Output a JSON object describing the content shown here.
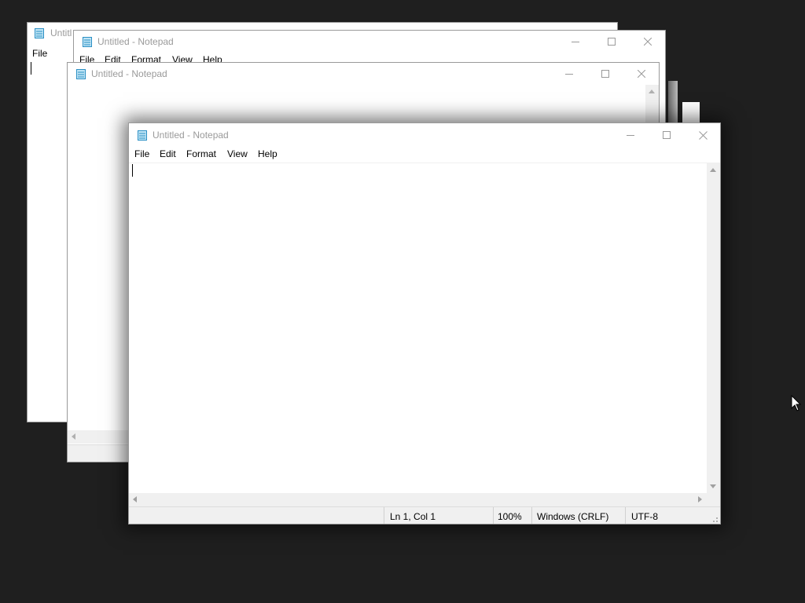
{
  "app": {
    "window_title": "Untitled - Notepad",
    "truncated_title": "Untitl",
    "menu": {
      "file": "File",
      "edit": "Edit",
      "format": "Format",
      "view": "View",
      "help": "Help"
    },
    "status": {
      "position": "Ln 1, Col 1",
      "zoom": "100%",
      "line_ending": "Windows (CRLF)",
      "encoding": "UTF-8"
    },
    "editor_text": ""
  },
  "icons": {
    "app": "notepad-icon",
    "minimize": "minimize-icon",
    "maximize": "maximize-icon",
    "close": "close-icon",
    "cursor": "mouse-pointer-icon"
  },
  "colors": {
    "desktop": "#1f1f1f",
    "title_inactive": "#9a9a9a",
    "icon_accent": "#2a8fc4",
    "chrome": "#f0f0f0"
  }
}
